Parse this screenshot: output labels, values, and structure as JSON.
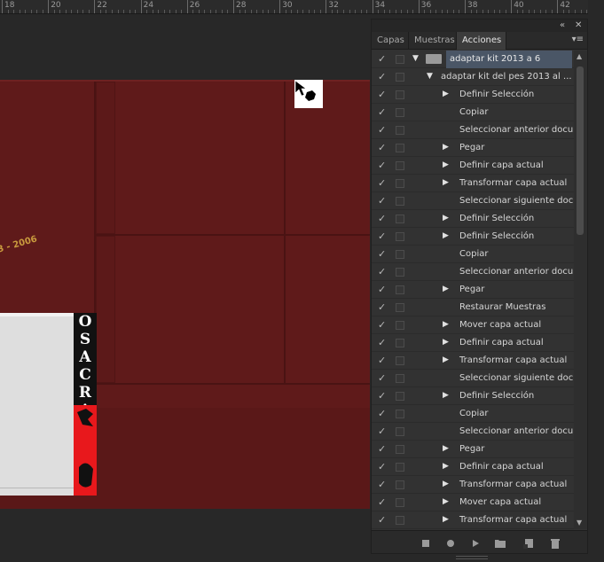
{
  "ruler": {
    "labels": [
      "18",
      "20",
      "22",
      "24",
      "26",
      "28",
      "30",
      "32",
      "34",
      "36",
      "38",
      "40",
      "42"
    ]
  },
  "document": {
    "date_text": "3 - 2006",
    "kit_letters": [
      "O",
      "S",
      "A",
      "C",
      "R",
      "A"
    ]
  },
  "panel": {
    "tabs": [
      {
        "label": "Capas",
        "active": false
      },
      {
        "label": "Muestras",
        "active": false
      },
      {
        "label": "Acciones",
        "active": true
      }
    ],
    "collapse_icon": "double-chevron-icon",
    "close_icon": "close-icon",
    "menu_icon": "panel-menu-icon",
    "rows": [
      {
        "label": "adaptar kit 2013 a 6",
        "level": 0,
        "expanded": true,
        "selected": true,
        "folder": true
      },
      {
        "label": "adaptar kit del pes 2013 al ...",
        "level": 1,
        "expanded": true
      },
      {
        "label": "Definir Selección",
        "level": 2,
        "expandable": true
      },
      {
        "label": "Copiar",
        "level": 2,
        "expandable": false
      },
      {
        "label": "Seleccionar anterior docu...",
        "level": 2,
        "expandable": false
      },
      {
        "label": "Pegar",
        "level": 2,
        "expandable": true
      },
      {
        "label": "Definir capa actual",
        "level": 2,
        "expandable": true
      },
      {
        "label": "Transformar capa actual",
        "level": 2,
        "expandable": true
      },
      {
        "label": "Seleccionar siguiente doc...",
        "level": 2,
        "expandable": false
      },
      {
        "label": "Definir Selección",
        "level": 2,
        "expandable": true
      },
      {
        "label": "Definir Selección",
        "level": 2,
        "expandable": true
      },
      {
        "label": "Copiar",
        "level": 2,
        "expandable": false
      },
      {
        "label": "Seleccionar anterior docu...",
        "level": 2,
        "expandable": false
      },
      {
        "label": "Pegar",
        "level": 2,
        "expandable": true
      },
      {
        "label": "Restaurar Muestras",
        "level": 2,
        "expandable": false
      },
      {
        "label": "Mover capa actual",
        "level": 2,
        "expandable": true
      },
      {
        "label": "Definir capa actual",
        "level": 2,
        "expandable": true
      },
      {
        "label": "Transformar capa actual",
        "level": 2,
        "expandable": true
      },
      {
        "label": "Seleccionar siguiente doc...",
        "level": 2,
        "expandable": false
      },
      {
        "label": "Definir Selección",
        "level": 2,
        "expandable": true
      },
      {
        "label": "Copiar",
        "level": 2,
        "expandable": false
      },
      {
        "label": "Seleccionar anterior docu...",
        "level": 2,
        "expandable": false
      },
      {
        "label": "Pegar",
        "level": 2,
        "expandable": true
      },
      {
        "label": "Definir capa actual",
        "level": 2,
        "expandable": true
      },
      {
        "label": "Transformar capa actual",
        "level": 2,
        "expandable": true
      },
      {
        "label": "Mover capa actual",
        "level": 2,
        "expandable": true
      },
      {
        "label": "Transformar capa actual",
        "level": 2,
        "expandable": true
      }
    ],
    "bottom_buttons": [
      "stop-icon",
      "record-icon",
      "play-icon",
      "new-set-icon",
      "new-action-icon",
      "trash-icon"
    ]
  },
  "colors": {
    "accent_selected": "#4a5666",
    "document_red": "#5f1a1a",
    "kit_red": "#e8181c",
    "date_gold": "#c99a3e"
  }
}
